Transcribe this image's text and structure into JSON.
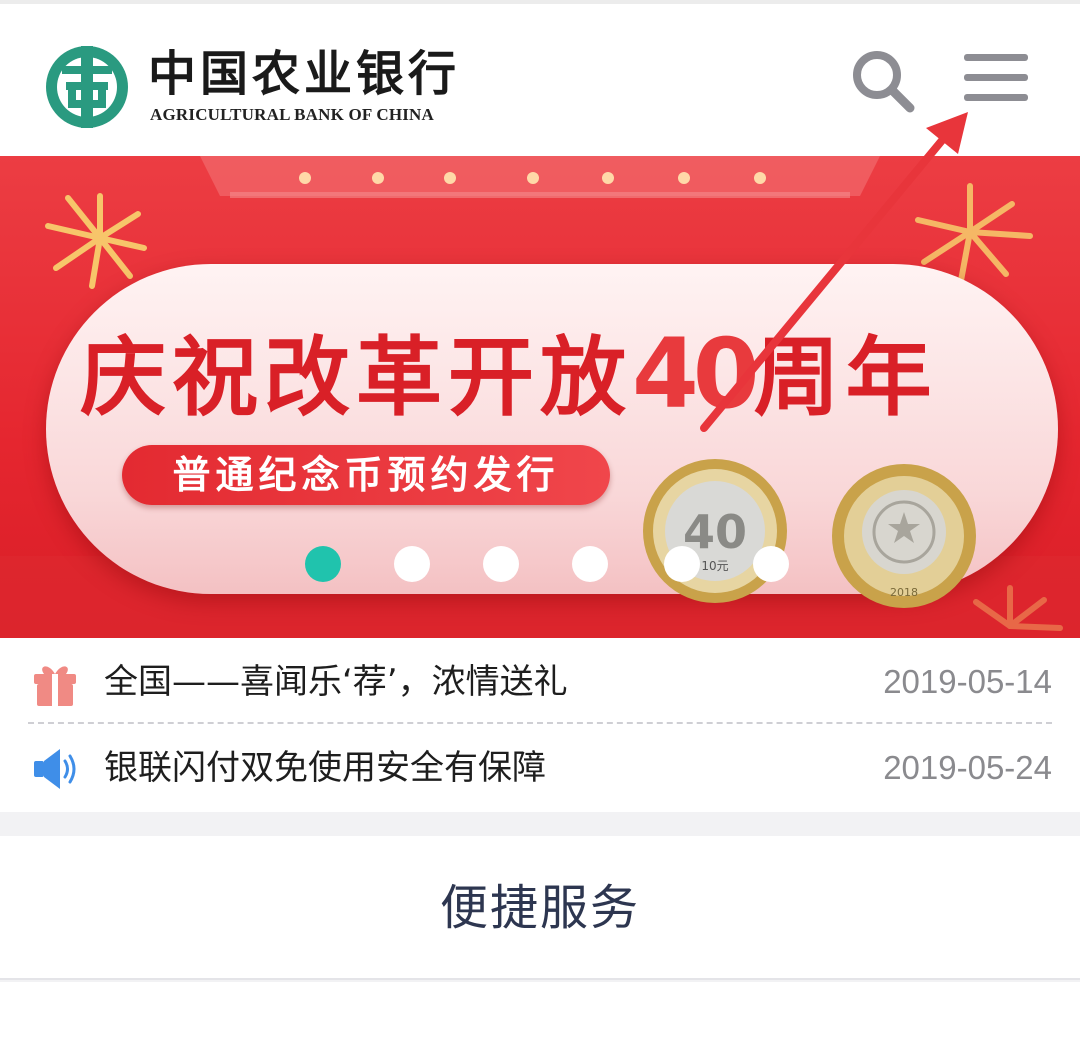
{
  "header": {
    "logo_cn": "中国农业银行",
    "logo_en": "AGRICULTURAL BANK OF CHINA",
    "logo_icon": "abc-logo-icon",
    "search_icon": "search-icon",
    "menu_icon": "hamburger-menu-icon"
  },
  "banner": {
    "title_part1": "庆祝改革开放",
    "title_forty": "40",
    "title_part2": "周年",
    "subtitle": "普通纪念币预约发行",
    "coin_left_number": "40",
    "coin_left_denomination": "10元",
    "coin_right_year": "2018",
    "carousel": {
      "total": 6,
      "active_index": 0
    },
    "colors": {
      "background": "#e5262f",
      "active_dot": "#20c3ad",
      "dot": "#ffffff"
    }
  },
  "news": [
    {
      "icon": "gift-icon",
      "title": "全国——喜闻乐‘荐’，浓情送礼",
      "date": "2019-05-14"
    },
    {
      "icon": "speaker-icon",
      "title": "银联闪付双免使用安全有保障",
      "date": "2019-05-24"
    }
  ],
  "services": {
    "title": "便捷服务"
  },
  "colors": {
    "brand_green": "#2a9a80",
    "annotation_arrow": "#e8353b",
    "text_dark": "#2d3650"
  }
}
